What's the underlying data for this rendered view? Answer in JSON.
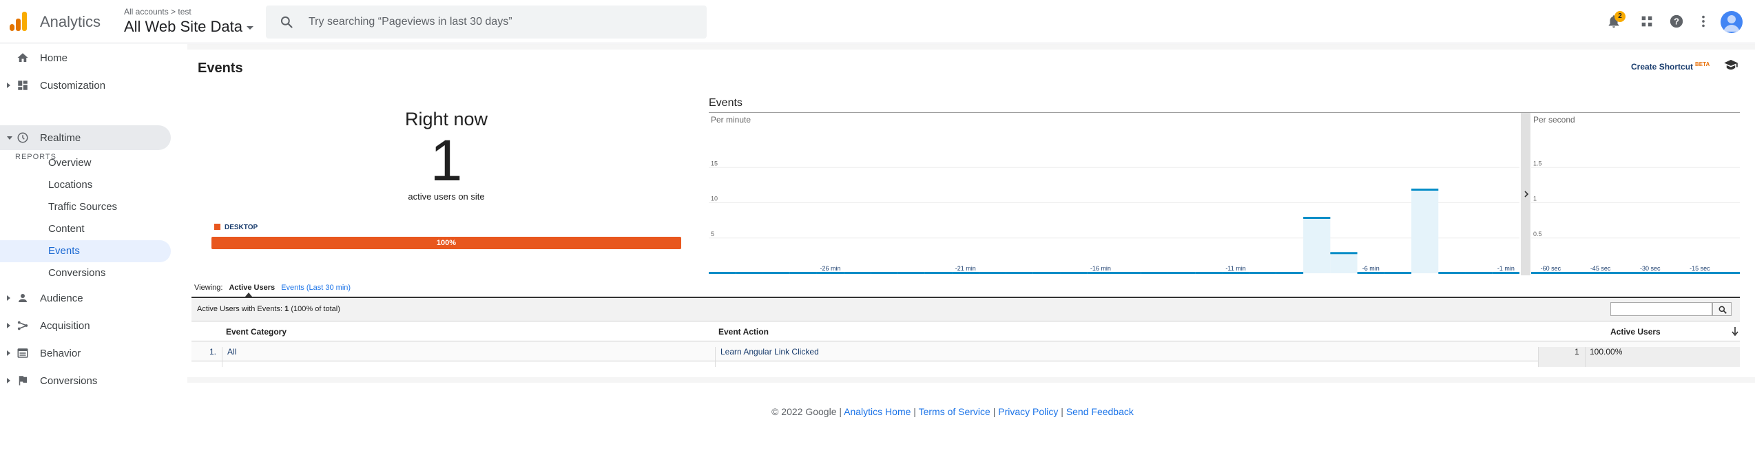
{
  "header": {
    "app_name": "Analytics",
    "account_crumb": "All accounts > test",
    "property": "All Web Site Data",
    "search_placeholder": "Try searching “Pageviews in last 30 days”",
    "notification_count": "2",
    "colors": {
      "logo_dark": "#e37400",
      "logo_light": "#f9ab00",
      "avatar": "#4285f4",
      "badge": "#f9ab00"
    }
  },
  "sidebar": {
    "home": "Home",
    "customization": "Customization",
    "reports_header": "REPORTS",
    "realtime": "Realtime",
    "realtime_items": [
      "Overview",
      "Locations",
      "Traffic Sources",
      "Content",
      "Events",
      "Conversions"
    ],
    "selected_item": "Events",
    "audience": "Audience",
    "acquisition": "Acquisition",
    "behavior": "Behavior",
    "conversions": "Conversions",
    "colors": {
      "selected_bg": "#e8f0fe",
      "selected_text": "#1967d2",
      "hover_bg": "#e8eaed"
    }
  },
  "main": {
    "title": "Events",
    "create_shortcut": "Create Shortcut",
    "beta": "BETA",
    "right_now": "Right now",
    "active_users": "1",
    "active_users_label": "active users on site",
    "device": {
      "label": "DESKTOP",
      "percent_label": "100%",
      "share": 1.0,
      "color": "#e8571e"
    }
  },
  "chart_data": [
    {
      "type": "bar",
      "title": "Events",
      "subtitle": "Per minute",
      "x_tick_labels": [
        "-26 min",
        "-21 min",
        "-16 min",
        "-11 min",
        "-6 min",
        "-1 min"
      ],
      "y_ticks": [
        5,
        10,
        15
      ],
      "ylim": [
        0,
        20
      ],
      "x_minutes_ago": [
        -30,
        -29,
        -28,
        -27,
        -26,
        -25,
        -24,
        -23,
        -22,
        -21,
        -20,
        -19,
        -18,
        -17,
        -16,
        -15,
        -14,
        -13,
        -12,
        -11,
        -10,
        -9,
        -8,
        -7,
        -6,
        -5,
        -4,
        -3,
        -2,
        -1
      ],
      "values": [
        0,
        0,
        0,
        0,
        0,
        0,
        0,
        0,
        0,
        0,
        0,
        0,
        0,
        0,
        0,
        0,
        0,
        0,
        0,
        0,
        0,
        0,
        8,
        3,
        0,
        0,
        12,
        0,
        0,
        0
      ],
      "color": "#058dc7",
      "fill": "#e5f3fa"
    },
    {
      "type": "bar",
      "subtitle": "Per second",
      "x_tick_labels": [
        "-60 sec",
        "-45 sec",
        "-30 sec",
        "-15 sec"
      ],
      "y_ticks": [
        0.5,
        1,
        1.5
      ],
      "ylim": [
        0,
        2
      ],
      "values": [],
      "color": "#058dc7"
    }
  ],
  "viewing": {
    "label": "Viewing:",
    "tabs": [
      "Active Users",
      "Events (Last 30 min)"
    ]
  },
  "table": {
    "summary_label": "Active Users with Events:",
    "summary_count": "1",
    "summary_pct": "(100% of total)",
    "headers": {
      "category": "Event Category",
      "action": "Event Action",
      "users": "Active Users"
    },
    "rows": [
      {
        "index": "1.",
        "category": "All",
        "action": "Learn Angular Link Clicked",
        "users": "1",
        "pct": "100.00%"
      }
    ]
  },
  "footer": {
    "copyright": "© 2022 Google",
    "links": [
      "Analytics Home",
      "Terms of Service",
      "Privacy Policy",
      "Send Feedback"
    ]
  }
}
